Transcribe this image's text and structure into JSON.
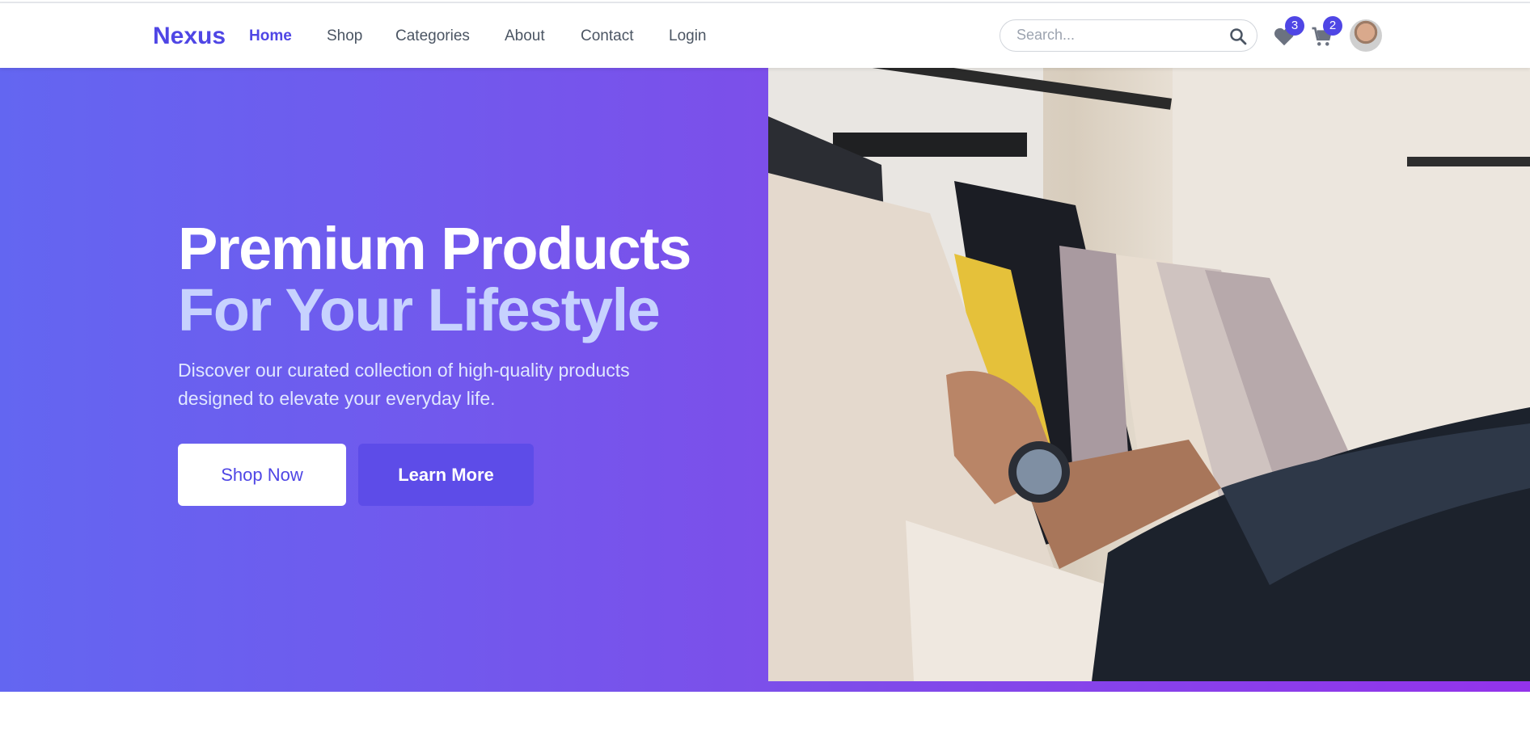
{
  "nav": {
    "logo": "Nexus",
    "links": [
      "Home",
      "Shop",
      "Categories",
      "About",
      "Contact",
      "Login"
    ],
    "active": "Home",
    "search_placeholder": "Search...",
    "wishlist_count": "3",
    "cart_count": "2",
    "accent": "#4f46e5"
  },
  "hero": {
    "title_line1": "Premium Products",
    "title_line2": "For Your Lifestyle",
    "subtitle": "Discover our curated collection of high-quality products designed to elevate your everyday life.",
    "primary_button": "Shop Now",
    "secondary_button": "Learn More",
    "gradient": [
      "#6366f1",
      "#9333ea"
    ]
  }
}
